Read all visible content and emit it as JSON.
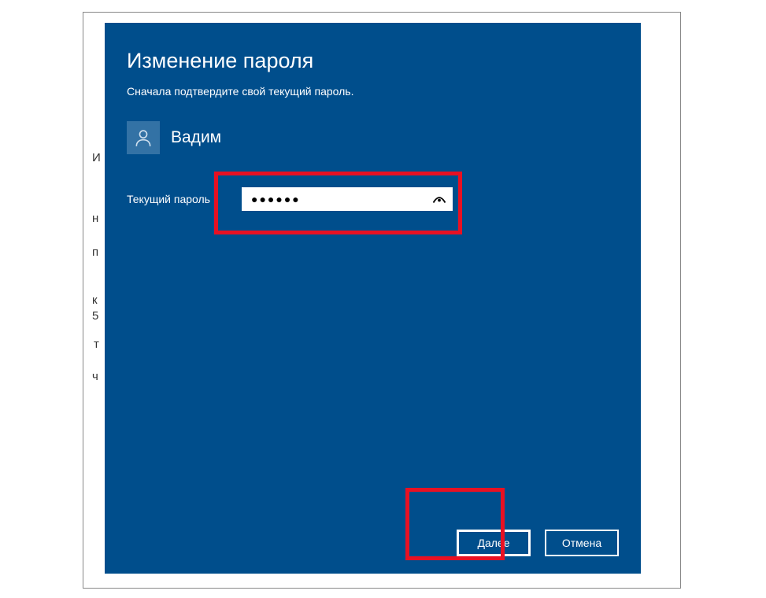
{
  "dialog": {
    "title": "Изменение пароля",
    "subtitle": "Сначала подтвердите свой текущий пароль."
  },
  "user": {
    "name": "Вадим"
  },
  "fields": {
    "current_password": {
      "label": "Текущий пароль",
      "masked_value": "●●●●●●"
    }
  },
  "buttons": {
    "next": "Далее",
    "cancel": "Отмена"
  },
  "bg_chars": {
    "c1": "И",
    "c2": "н",
    "c3": "п",
    "c4": "к",
    "c5": "5",
    "c6": "т",
    "c7": "ч"
  }
}
